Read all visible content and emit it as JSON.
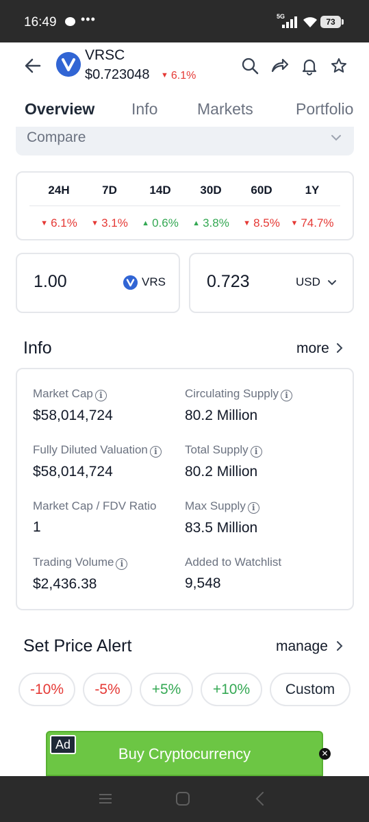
{
  "status": {
    "time": "16:49",
    "network": "5G",
    "battery": "73"
  },
  "header": {
    "coin_symbol": "VRSC",
    "price": "$0.723048",
    "change": "6.1%"
  },
  "tabs": [
    {
      "label": "Overview"
    },
    {
      "label": "Info"
    },
    {
      "label": "Markets"
    },
    {
      "label": "Portfolio"
    }
  ],
  "compare": {
    "label": "Compare"
  },
  "performance": {
    "periods": [
      "24H",
      "7D",
      "14D",
      "30D",
      "60D",
      "1Y"
    ],
    "changes": [
      {
        "value": "6.1%",
        "direction": "down"
      },
      {
        "value": "3.1%",
        "direction": "down"
      },
      {
        "value": "0.6%",
        "direction": "up"
      },
      {
        "value": "3.8%",
        "direction": "up"
      },
      {
        "value": "8.5%",
        "direction": "down"
      },
      {
        "value": "74.7%",
        "direction": "down"
      }
    ]
  },
  "converter": {
    "crypto_amount": "1.00",
    "crypto_unit": "VRS",
    "fiat_amount": "0.723",
    "fiat_unit": "USD"
  },
  "info": {
    "title": "Info",
    "more_label": "more",
    "items": [
      {
        "label": "Market Cap",
        "value": "$58,014,724",
        "has_info": true
      },
      {
        "label": "Circulating Supply",
        "value": "80.2 Million",
        "has_info": true
      },
      {
        "label": "Fully Diluted Valuation",
        "value": "$58,014,724",
        "has_info": true
      },
      {
        "label": "Total Supply",
        "value": "80.2 Million",
        "has_info": true
      },
      {
        "label": "Market Cap / FDV Ratio",
        "value": "1",
        "has_info": false
      },
      {
        "label": "Max Supply",
        "value": "83.5 Million",
        "has_info": true
      },
      {
        "label": "Trading Volume",
        "value": "$2,436.38",
        "has_info": true
      },
      {
        "label": "Added to Watchlist",
        "value": "9,548",
        "has_info": false
      }
    ]
  },
  "price_alert": {
    "title": "Set Price Alert",
    "manage_label": "manage",
    "options": [
      {
        "label": "-10%",
        "tone": "down"
      },
      {
        "label": "-5%",
        "tone": "down"
      },
      {
        "label": "+5%",
        "tone": "up"
      },
      {
        "label": "+10%",
        "tone": "up"
      },
      {
        "label": "Custom",
        "tone": "neutral"
      }
    ]
  },
  "ad": {
    "badge": "Ad",
    "text": "Buy Cryptocurrency"
  },
  "colors": {
    "down": "#e53935",
    "up": "#34a853",
    "brand_blue": "#3165d4",
    "ad_green": "#6cc644"
  }
}
